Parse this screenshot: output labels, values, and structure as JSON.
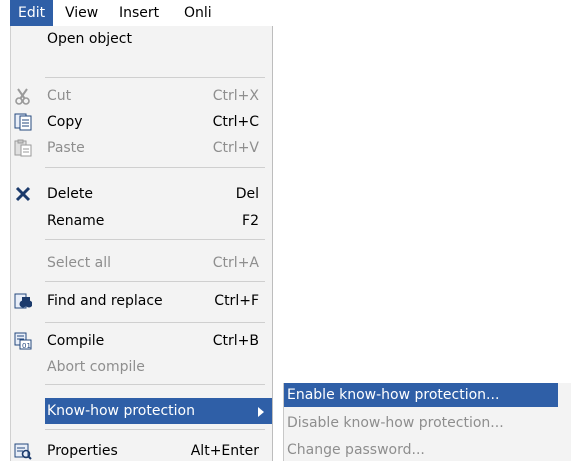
{
  "menubar": {
    "items": [
      {
        "label": "Edit"
      },
      {
        "label": "View"
      },
      {
        "label": "Insert"
      },
      {
        "label": "Onli"
      }
    ]
  },
  "edit_menu": {
    "open_object": {
      "label": "Open object"
    },
    "cut": {
      "label": "Cut",
      "shortcut": "Ctrl+X",
      "icon": "scissors-icon"
    },
    "copy": {
      "label": "Copy",
      "shortcut": "Ctrl+C",
      "icon": "copy-icon"
    },
    "paste": {
      "label": "Paste",
      "shortcut": "Ctrl+V",
      "icon": "paste-icon"
    },
    "delete": {
      "label": "Delete",
      "shortcut": "Del",
      "icon": "delete-x-icon"
    },
    "rename": {
      "label": "Rename",
      "shortcut": "F2"
    },
    "select_all": {
      "label": "Select all",
      "shortcut": "Ctrl+A"
    },
    "find_replace": {
      "label": "Find and replace",
      "shortcut": "Ctrl+F",
      "icon": "binoculars-icon"
    },
    "compile": {
      "label": "Compile",
      "shortcut": "Ctrl+B",
      "icon": "compile-icon"
    },
    "abort_compile": {
      "label": "Abort compile"
    },
    "know_how": {
      "label": "Know-how protection"
    },
    "properties": {
      "label": "Properties",
      "shortcut": "Alt+Enter",
      "icon": "properties-icon"
    }
  },
  "submenu": {
    "enable": {
      "label": "Enable know-how protection..."
    },
    "disable": {
      "label": "Disable know-how protection..."
    },
    "change_password": {
      "label": "Change password..."
    }
  },
  "colors": {
    "highlight": "#2f5fa7",
    "menu_bg": "#f3f3f3",
    "disabled": "#8e8e8e"
  }
}
